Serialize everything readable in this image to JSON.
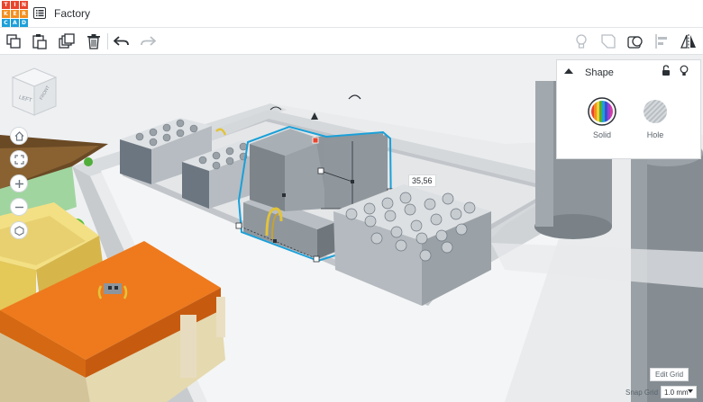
{
  "app": {
    "logo_letters": [
      "TIN",
      "KER",
      "CAD"
    ],
    "logo_colors": [
      "#e8452c",
      "#e8452c",
      "#e8452c",
      "#f48f1f",
      "#f48f1f",
      "#f48f1f",
      "#1d9fd9",
      "#1d9fd9",
      "#1d9fd9"
    ],
    "title": "Factory"
  },
  "toolbar": {
    "left": [
      "copy-icon",
      "paste-icon",
      "duplicate-icon",
      "delete-icon",
      "undo-icon",
      "redo-icon"
    ],
    "right": [
      "light-bulb-icon",
      "note-icon",
      "group-icon",
      "align-icon",
      "mirror-icon"
    ]
  },
  "viewcube": {
    "left_label": "LEFT",
    "front_label": "FRONT"
  },
  "nav": [
    "home-icon",
    "fit-icon",
    "zoom-in-icon",
    "zoom-out-icon",
    "perspective-icon"
  ],
  "shape_panel": {
    "title": "Shape",
    "solid_label": "Solid",
    "hole_label": "Hole"
  },
  "dimension_label": "35,56",
  "grid": {
    "edit_label": "Edit Grid",
    "snap_label": "Snap Grid",
    "snap_value": "1.0 mm"
  },
  "colors": {
    "selection": "#1aa0d8",
    "orange_block": "#ee7a1d",
    "accent_red": "#e8452c"
  }
}
